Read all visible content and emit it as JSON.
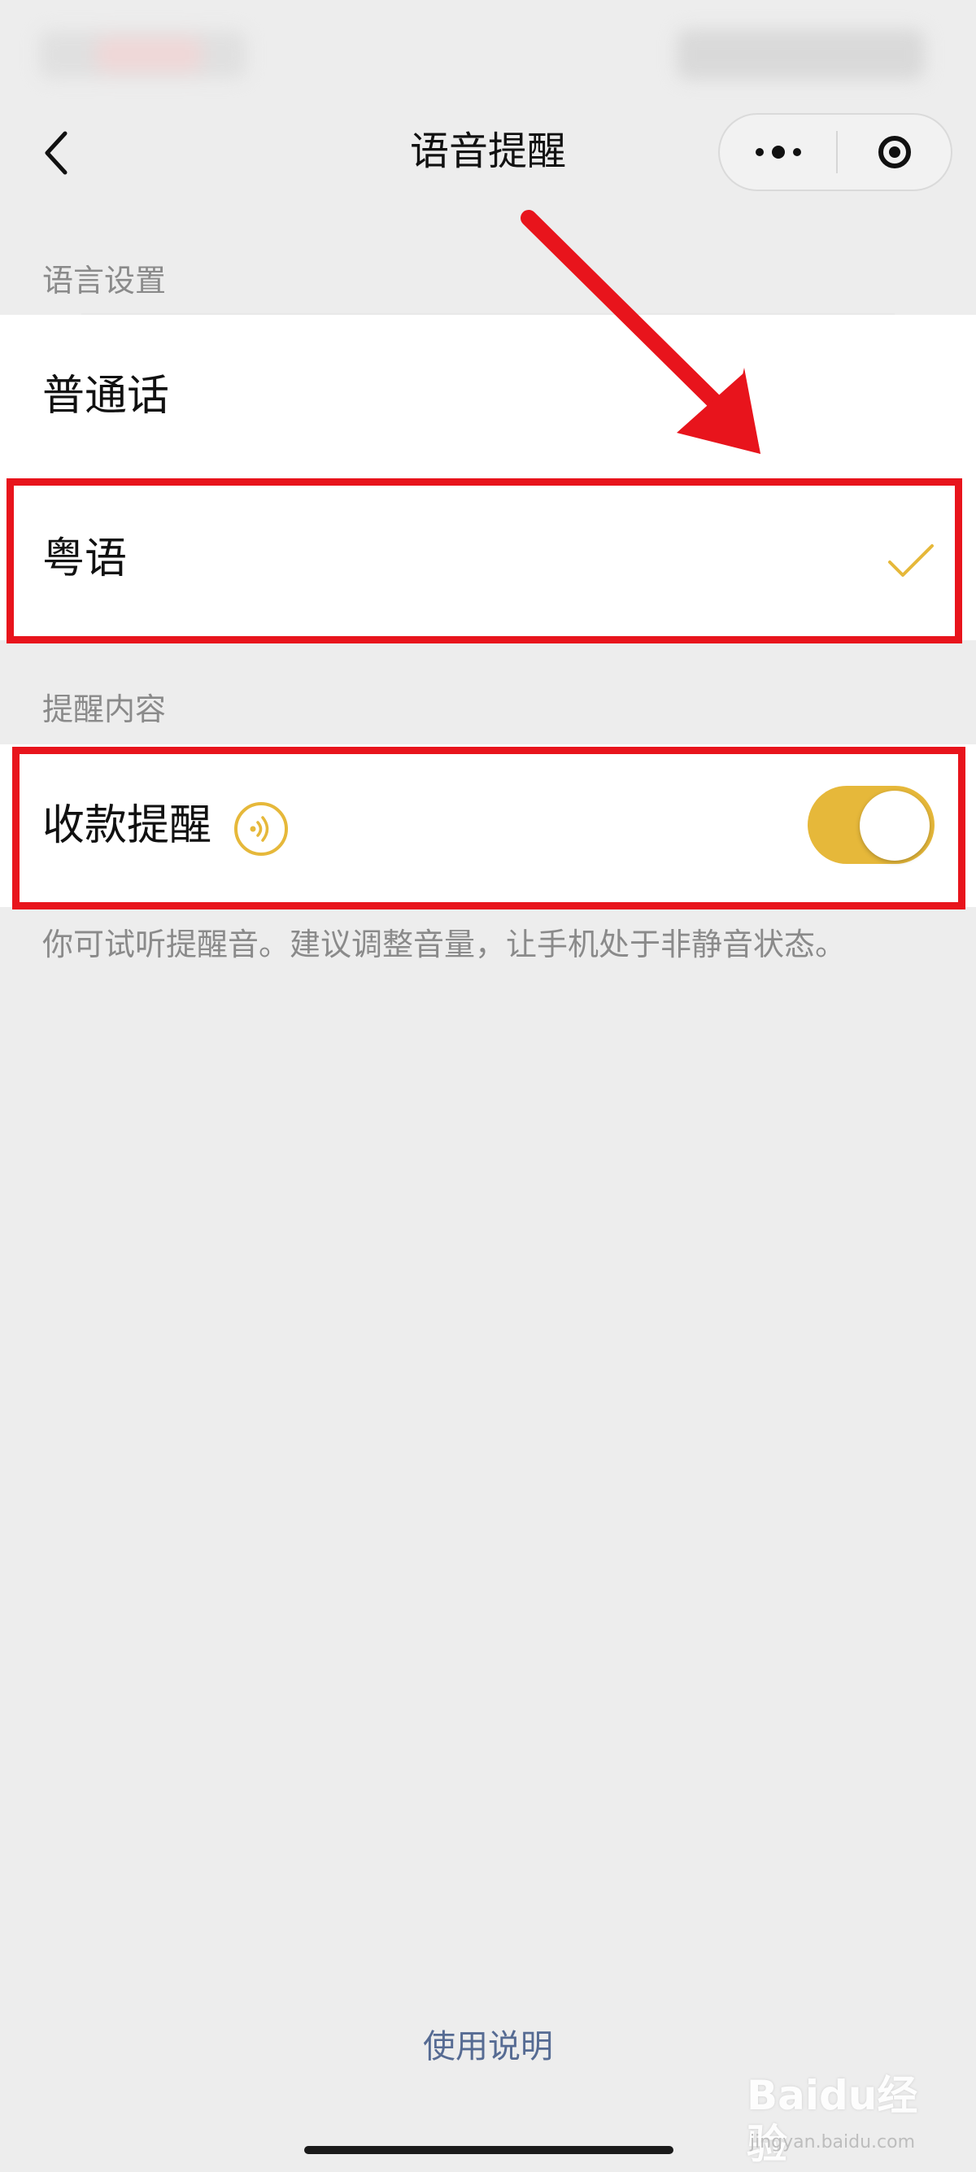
{
  "nav": {
    "title": "语音提醒"
  },
  "language_section": {
    "header": "语言设置",
    "options": [
      {
        "label": "普通话",
        "selected": false
      },
      {
        "label": "粤语",
        "selected": true
      }
    ]
  },
  "content_section": {
    "header": "提醒内容",
    "payment_alert": {
      "label": "收款提醒",
      "enabled": true
    },
    "hint": "你可试听提醒音。建议调整音量，让手机处于非静音状态。"
  },
  "footer": {
    "link": "使用说明"
  },
  "watermark": {
    "main": "Baidu经验",
    "sub": "jingyan.baidu.com"
  },
  "colors": {
    "accent": "#e6b83a",
    "annotation_red": "#e8141c",
    "link": "#566b93",
    "background": "#ededed"
  }
}
